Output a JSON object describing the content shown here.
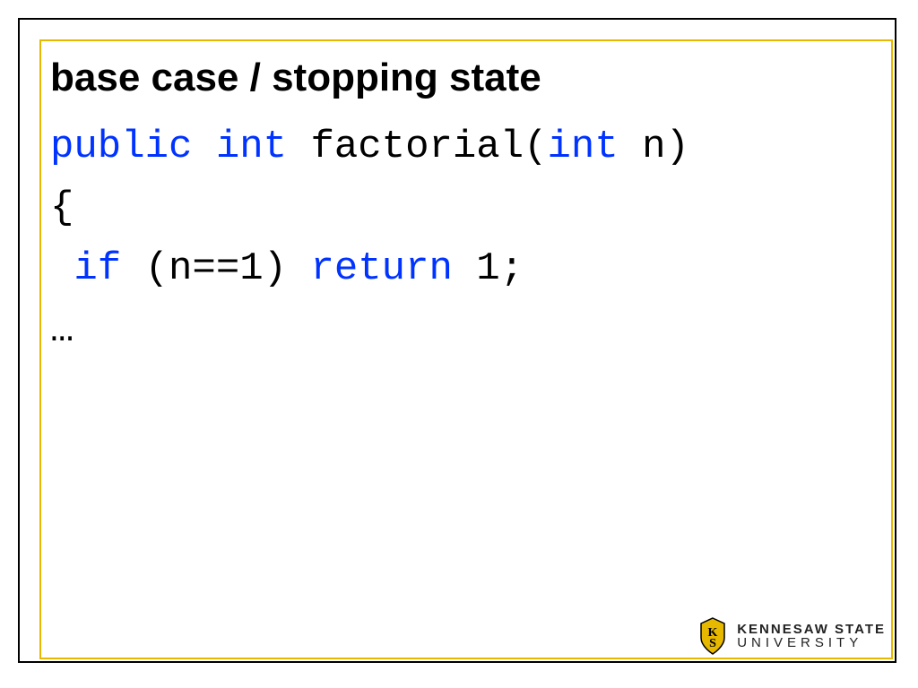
{
  "slide": {
    "title": "base case / stopping state",
    "code": {
      "kw_public": "public",
      "kw_int1": "int",
      "fn_name": " factorial(",
      "kw_int2": "int",
      "param": " n)",
      "brace": "{",
      "indent": " ",
      "kw_if": "if",
      "cond": " (n==1) ",
      "kw_return": "return",
      "one": " 1;",
      "ellipsis": "…"
    }
  },
  "branding": {
    "name_top": "KENNESAW STATE",
    "name_bottom": "UNIVERSITY"
  }
}
